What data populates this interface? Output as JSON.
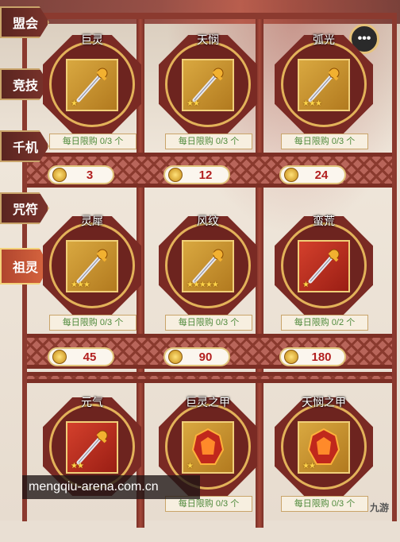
{
  "tabs": [
    {
      "label": "盟会",
      "active": false
    },
    {
      "label": "竞技",
      "active": false
    },
    {
      "label": "千机",
      "active": false
    },
    {
      "label": "咒符",
      "active": false
    },
    {
      "label": "祖灵",
      "active": true
    }
  ],
  "chat_button": {
    "icon": "chat-bubble-icon"
  },
  "items": [
    {
      "name": "巨灵",
      "limit": "每日限购 0/3 个",
      "stars": "★",
      "slot": "gold"
    },
    {
      "name": "天悯",
      "limit": "每日限购 0/3 个",
      "stars": "★★",
      "slot": "gold"
    },
    {
      "name": "弧光",
      "limit": "每日限购 0/3 个",
      "stars": "★★★",
      "slot": "gold"
    },
    {
      "name": "灵犀",
      "limit": "每日限购 0/3 个",
      "stars": "★★★",
      "slot": "gold"
    },
    {
      "name": "风纹",
      "limit": "每日限购 0/3 个",
      "stars": "★★★★★",
      "slot": "gold"
    },
    {
      "name": "蛮荒",
      "limit": "每日限购 0/2 个",
      "stars": "★",
      "slot": "red"
    },
    {
      "name": "元气",
      "limit": "",
      "stars": "★★",
      "slot": "red"
    },
    {
      "name": "巨灵之甲",
      "limit": "每日限购 0/3 个",
      "stars": "★",
      "slot": "gold"
    },
    {
      "name": "天悯之甲",
      "limit": "每日限购 0/3 个",
      "stars": "★★",
      "slot": "gold"
    }
  ],
  "prices": [
    "3",
    "12",
    "24",
    "45",
    "90",
    "180"
  ],
  "watermark": "mengqiu-arena.com.cn",
  "logo": "九游"
}
